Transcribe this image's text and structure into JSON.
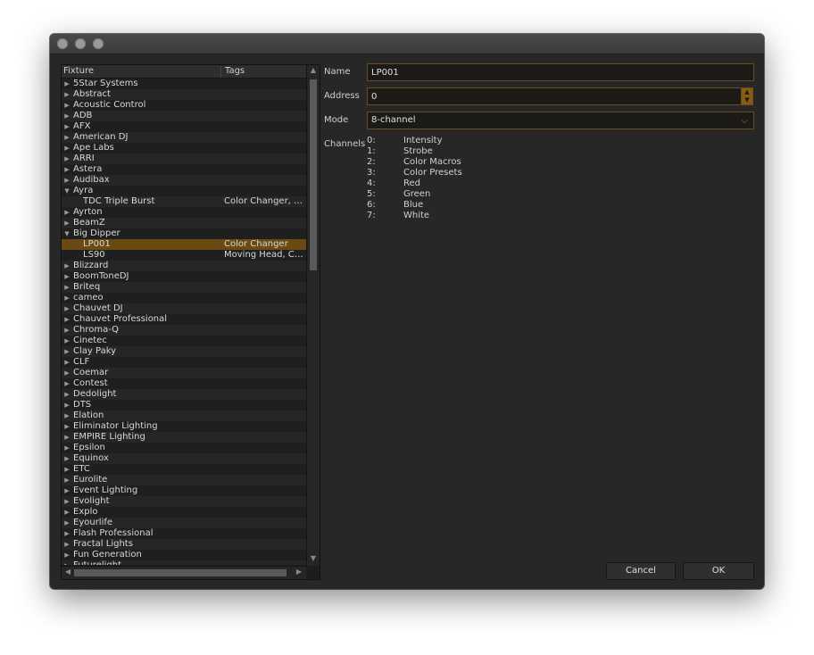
{
  "tree": {
    "header": {
      "fixture": "Fixture",
      "tags": "Tags"
    },
    "rows": [
      {
        "label": "5Star Systems",
        "state": "collapsed",
        "level": 0,
        "tags": ""
      },
      {
        "label": "Abstract",
        "state": "collapsed",
        "level": 0,
        "tags": ""
      },
      {
        "label": "Acoustic Control",
        "state": "collapsed",
        "level": 0,
        "tags": ""
      },
      {
        "label": "ADB",
        "state": "collapsed",
        "level": 0,
        "tags": ""
      },
      {
        "label": "AFX",
        "state": "collapsed",
        "level": 0,
        "tags": ""
      },
      {
        "label": "American DJ",
        "state": "collapsed",
        "level": 0,
        "tags": ""
      },
      {
        "label": "Ape Labs",
        "state": "collapsed",
        "level": 0,
        "tags": ""
      },
      {
        "label": "ARRI",
        "state": "collapsed",
        "level": 0,
        "tags": ""
      },
      {
        "label": "Astera",
        "state": "collapsed",
        "level": 0,
        "tags": ""
      },
      {
        "label": "Audibax",
        "state": "collapsed",
        "level": 0,
        "tags": ""
      },
      {
        "label": "Ayra",
        "state": "expanded",
        "level": 0,
        "tags": ""
      },
      {
        "label": "TDC Triple Burst",
        "state": "leaf",
        "level": 1,
        "tags": "Color Changer, Effect"
      },
      {
        "label": "Ayrton",
        "state": "collapsed",
        "level": 0,
        "tags": ""
      },
      {
        "label": "BeamZ",
        "state": "collapsed",
        "level": 0,
        "tags": ""
      },
      {
        "label": "Big Dipper",
        "state": "expanded",
        "level": 0,
        "tags": ""
      },
      {
        "label": "LP001",
        "state": "leaf",
        "level": 1,
        "tags": "Color Changer",
        "selected": true
      },
      {
        "label": "LS90",
        "state": "leaf",
        "level": 1,
        "tags": "Moving Head, Color Changer"
      },
      {
        "label": "Blizzard",
        "state": "collapsed",
        "level": 0,
        "tags": ""
      },
      {
        "label": "BoomToneDJ",
        "state": "collapsed",
        "level": 0,
        "tags": ""
      },
      {
        "label": "Briteq",
        "state": "collapsed",
        "level": 0,
        "tags": ""
      },
      {
        "label": "cameo",
        "state": "collapsed",
        "level": 0,
        "tags": ""
      },
      {
        "label": "Chauvet DJ",
        "state": "collapsed",
        "level": 0,
        "tags": ""
      },
      {
        "label": "Chauvet Professional",
        "state": "collapsed",
        "level": 0,
        "tags": ""
      },
      {
        "label": "Chroma-Q",
        "state": "collapsed",
        "level": 0,
        "tags": ""
      },
      {
        "label": "Cinetec",
        "state": "collapsed",
        "level": 0,
        "tags": ""
      },
      {
        "label": "Clay Paky",
        "state": "collapsed",
        "level": 0,
        "tags": ""
      },
      {
        "label": "CLF",
        "state": "collapsed",
        "level": 0,
        "tags": ""
      },
      {
        "label": "Coemar",
        "state": "collapsed",
        "level": 0,
        "tags": ""
      },
      {
        "label": "Contest",
        "state": "collapsed",
        "level": 0,
        "tags": ""
      },
      {
        "label": "Dedolight",
        "state": "collapsed",
        "level": 0,
        "tags": ""
      },
      {
        "label": "DTS",
        "state": "collapsed",
        "level": 0,
        "tags": ""
      },
      {
        "label": "Elation",
        "state": "collapsed",
        "level": 0,
        "tags": ""
      },
      {
        "label": "Eliminator Lighting",
        "state": "collapsed",
        "level": 0,
        "tags": ""
      },
      {
        "label": "EMPIRE Lighting",
        "state": "collapsed",
        "level": 0,
        "tags": ""
      },
      {
        "label": "Epsilon",
        "state": "collapsed",
        "level": 0,
        "tags": ""
      },
      {
        "label": "Equinox",
        "state": "collapsed",
        "level": 0,
        "tags": ""
      },
      {
        "label": "ETC",
        "state": "collapsed",
        "level": 0,
        "tags": ""
      },
      {
        "label": "Eurolite",
        "state": "collapsed",
        "level": 0,
        "tags": ""
      },
      {
        "label": "Event Lighting",
        "state": "collapsed",
        "level": 0,
        "tags": ""
      },
      {
        "label": "Evolight",
        "state": "collapsed",
        "level": 0,
        "tags": ""
      },
      {
        "label": "Explo",
        "state": "collapsed",
        "level": 0,
        "tags": ""
      },
      {
        "label": "Eyourlife",
        "state": "collapsed",
        "level": 0,
        "tags": ""
      },
      {
        "label": "Flash Professional",
        "state": "collapsed",
        "level": 0,
        "tags": ""
      },
      {
        "label": "Fractal Lights",
        "state": "collapsed",
        "level": 0,
        "tags": ""
      },
      {
        "label": "Fun Generation",
        "state": "collapsed",
        "level": 0,
        "tags": ""
      },
      {
        "label": "Futurelight",
        "state": "collapsed",
        "level": 0,
        "tags": ""
      }
    ]
  },
  "form": {
    "name_label": "Name",
    "name_value": "LP001",
    "address_label": "Address",
    "address_value": "0",
    "mode_label": "Mode",
    "mode_value": "8-channel",
    "channels_label": "Channels",
    "channels": [
      {
        "index": "0:",
        "name": "Intensity"
      },
      {
        "index": "1:",
        "name": "Strobe"
      },
      {
        "index": "2:",
        "name": "Color Macros"
      },
      {
        "index": "3:",
        "name": "Color Presets"
      },
      {
        "index": "4:",
        "name": "Red"
      },
      {
        "index": "5:",
        "name": "Green"
      },
      {
        "index": "6:",
        "name": "Blue"
      },
      {
        "index": "7:",
        "name": "White"
      }
    ]
  },
  "buttons": {
    "cancel": "Cancel",
    "ok": "OK"
  },
  "colors": {
    "accent": "#8a5a12",
    "selection": "#6a4a12",
    "window_bg": "#272727"
  }
}
